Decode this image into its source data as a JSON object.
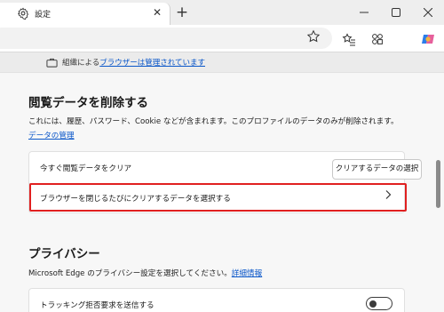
{
  "tab": {
    "title": "設定",
    "favicon": "gear-icon"
  },
  "window": {
    "minimize": "minimize-icon",
    "maximize": "maximize-icon",
    "close": "close-icon"
  },
  "toolbar": {
    "favorite": "star-icon",
    "favorites": "favorites-icon",
    "extensions": "extensions-icon",
    "copilot": "copilot-icon"
  },
  "managed": {
    "prefix": "組織による",
    "link": "ブラウザーは管理されています"
  },
  "clear_section": {
    "title": "閲覧データを削除する",
    "desc": "これには、履歴、パスワード、Cookie などが含まれます。このプロファイルのデータのみが削除されます。",
    "desc_link": "データの管理",
    "row_now_label": "今すぐ閲覧データをクリア",
    "row_now_button": "クリアするデータの選択",
    "row_close_label": "ブラウザーを閉じるたびにクリアするデータを選択する"
  },
  "privacy": {
    "title": "プライバシー",
    "desc": "Microsoft Edge のプライバシー設定を選択してください。",
    "desc_link": "詳細情報",
    "dnt_label": "トラッキング拒否要求を送信する",
    "dnt_enabled": false
  },
  "colors": {
    "accent_link": "#0b57c9",
    "highlight_border": "#e02020"
  }
}
